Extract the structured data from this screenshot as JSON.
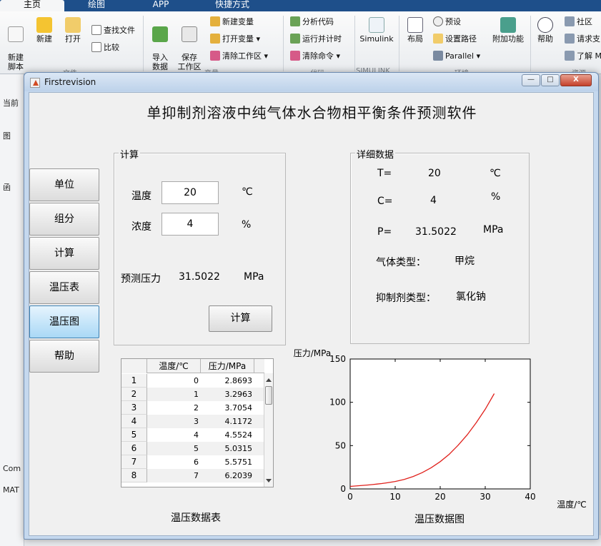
{
  "matlab": {
    "tabs": [
      "主页",
      "绘图",
      "APP",
      "快捷方式"
    ],
    "ribbon": {
      "new_script": "新建\n脚本",
      "new": "新建",
      "open": "打开",
      "find_files": "查找文件",
      "compare": "比较",
      "import_data": "导入\n数据",
      "save_workspace": "保存\n工作区",
      "new_variable": "新建变量",
      "open_variable": "打开变量 ▾",
      "clear_workspace": "清除工作区 ▾",
      "analyze_code": "分析代码",
      "run_and_time": "运行并计时",
      "clear_commands": "清除命令 ▾",
      "simulink": "Simulink",
      "layout": "布局",
      "preferences": "预设",
      "set_path": "设置路径",
      "parallel": "Parallel ▾",
      "addons": "附加功能",
      "help": "帮助",
      "community": "社区",
      "request_support": "请求支",
      "learn": "了解 M",
      "groups": [
        "文件",
        "变量",
        "代码",
        "SIMULINK",
        "环境",
        "资源"
      ]
    },
    "left_pane": [
      "当前",
      "图",
      "函",
      "Com",
      "MAT"
    ]
  },
  "window": {
    "title": "Firstrevision",
    "minimize": "—",
    "maximize": "□",
    "close": "X"
  },
  "app": {
    "title": "单抑制剂溶液中纯气体水合物相平衡条件预测软件",
    "nav": [
      "单位",
      "组分",
      "计算",
      "温压表",
      "温压图",
      "帮助"
    ],
    "active_nav": "温压图",
    "calc_panel": {
      "title": "计算",
      "temp_label": "温度",
      "temp_value": "20",
      "temp_unit": "℃",
      "conc_label": "浓度",
      "conc_value": "4",
      "conc_unit": "%",
      "pressure_label": "预测压力",
      "pressure_value": "31.5022",
      "pressure_unit": "MPa",
      "calc_button": "计算"
    },
    "detail_panel": {
      "title": "详细数据",
      "t_label": "T=",
      "t_value": "20",
      "t_unit": "℃",
      "c_label": "C=",
      "c_value": "4",
      "c_unit": "%",
      "p_label": "P=",
      "p_value": "31.5022",
      "p_unit": "MPa",
      "gas_label": "气体类型：",
      "gas_value": "甲烷",
      "inhibitor_label": "抑制剂类型：",
      "inhibitor_value": "氯化钠"
    },
    "table": {
      "headers": [
        "温度/℃",
        "压力/MPa"
      ],
      "rows": [
        {
          "n": "1",
          "t": "0",
          "p": "2.8693"
        },
        {
          "n": "2",
          "t": "1",
          "p": "3.2963"
        },
        {
          "n": "3",
          "t": "2",
          "p": "3.7054"
        },
        {
          "n": "4",
          "t": "3",
          "p": "4.1172"
        },
        {
          "n": "5",
          "t": "4",
          "p": "4.5524"
        },
        {
          "n": "6",
          "t": "5",
          "p": "5.0315"
        },
        {
          "n": "7",
          "t": "6",
          "p": "5.5751"
        },
        {
          "n": "8",
          "t": "7",
          "p": "6.2039"
        }
      ],
      "caption": "温压数据表"
    },
    "chart_caption": "温压数据图"
  },
  "chart_data": {
    "type": "line",
    "title": "",
    "xlabel": "温度/℃",
    "ylabel": "压力/MPa",
    "xlim": [
      0,
      40
    ],
    "ylim": [
      0,
      150
    ],
    "xticks": [
      0,
      10,
      20,
      30,
      40
    ],
    "yticks": [
      0,
      50,
      100,
      150
    ],
    "grid": false,
    "series": [
      {
        "color": "#e0201b",
        "x": [
          0,
          1,
          2,
          3,
          4,
          5,
          6,
          7,
          8,
          10,
          12,
          14,
          16,
          18,
          20,
          22,
          24,
          26,
          28,
          30,
          32
        ],
        "y": [
          2.87,
          3.3,
          3.71,
          4.12,
          4.55,
          5.03,
          5.58,
          6.2,
          6.9,
          8.6,
          11.0,
          14.3,
          18.8,
          24.5,
          31.5,
          40.0,
          50.5,
          62.5,
          76.5,
          92.0,
          110.0
        ]
      }
    ]
  }
}
